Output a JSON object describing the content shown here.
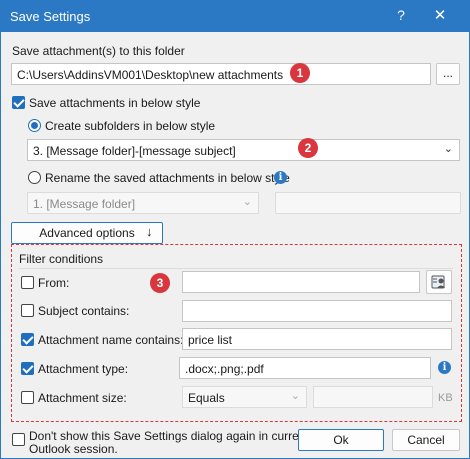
{
  "window": {
    "title": "Save Settings",
    "help_glyph": "?",
    "close_glyph": "✕"
  },
  "folder": {
    "label": "Save attachment(s) to this folder",
    "path": "C:\\Users\\AddinsVM001\\Desktop\\new attachments",
    "browse_label": "...",
    "callout": "1"
  },
  "style": {
    "checkbox_label": "Save attachments in below style",
    "checked": true,
    "subfolders_label": "Create subfolders in below style",
    "subfolder_value": "3. [Message folder]-[message subject]",
    "callout": "2",
    "rename_label": "Rename the saved attachments in below style",
    "rename_value": "1. [Message folder]"
  },
  "advanced": {
    "label": "Advanced options",
    "chevron": "»"
  },
  "filter": {
    "title": "Filter conditions",
    "callout": "3",
    "from_label": "From:",
    "subject_label": "Subject contains:",
    "attachment_name_label": "Attachment name contains:",
    "attachment_name_value": " price list",
    "attachment_type_label": "Attachment type:",
    "attachment_type_value": ".docx;.png;.pdf",
    "attachment_size_label": "Attachment size:",
    "size_operator": "Equals",
    "size_unit": "KB"
  },
  "footer": {
    "dont_show_label_line1": "Don't show this Save Settings dialog again in current",
    "dont_show_label_line2": "Outlook session.",
    "ok_label": "Ok",
    "cancel_label": "Cancel"
  },
  "colors": {
    "accent": "#2b78c5",
    "callout": "#d9363e"
  }
}
